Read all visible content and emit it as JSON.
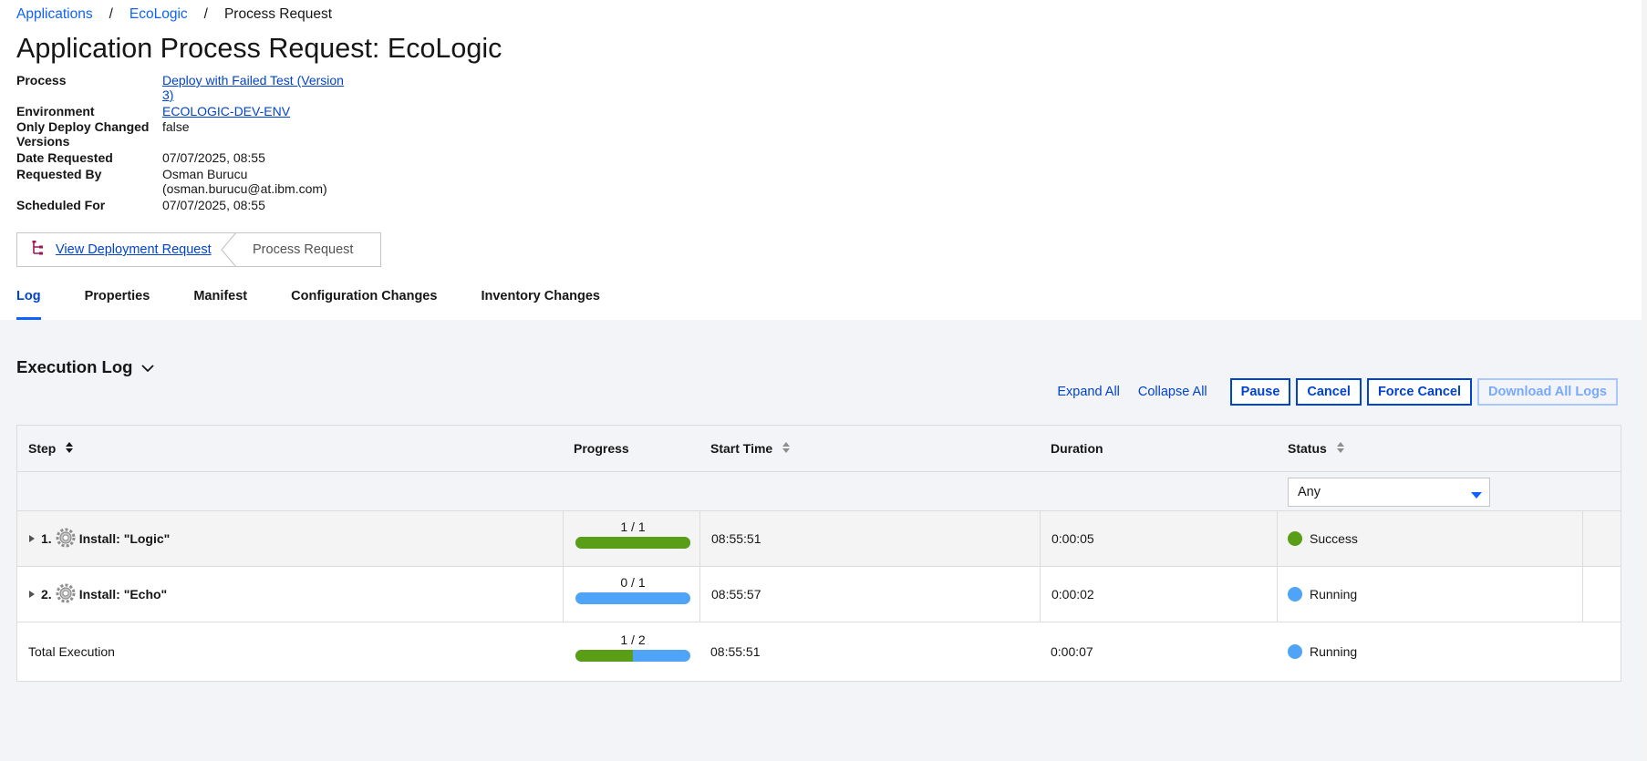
{
  "breadcrumb": {
    "items": [
      "Applications",
      "EcoLogic"
    ],
    "current": "Process Request",
    "separator": "/"
  },
  "title": "Application Process Request: EcoLogic",
  "details": {
    "process": {
      "label": "Process",
      "value_line1": "Deploy with Failed Test (Version",
      "value_line2": "3)"
    },
    "environment": {
      "label": "Environment",
      "value": "ECOLOGIC-DEV-ENV"
    },
    "only_changed": {
      "label_line1": "Only Deploy Changed",
      "label_line2": "Versions",
      "value": "false"
    },
    "date_requested": {
      "label": "Date Requested",
      "value": "07/07/2025, 08:55"
    },
    "requested_by": {
      "label": "Requested By",
      "value_line1": "Osman Burucu",
      "value_line2": "(osman.burucu@at.ibm.com)"
    },
    "scheduled_for": {
      "label": "Scheduled For",
      "value": "07/07/2025, 08:55"
    }
  },
  "switcher": {
    "deployment_label": "View Deployment Request",
    "process_label": "Process Request",
    "icon": "tree-icon"
  },
  "tabs": [
    {
      "label": "Log",
      "active": true
    },
    {
      "label": "Properties",
      "active": false
    },
    {
      "label": "Manifest",
      "active": false
    },
    {
      "label": "Configuration Changes",
      "active": false
    },
    {
      "label": "Inventory Changes",
      "active": false
    }
  ],
  "execution_log": {
    "title": "Execution Log",
    "actions": {
      "expand_all": "Expand All",
      "collapse_all": "Collapse All",
      "pause": "Pause",
      "cancel": "Cancel",
      "force_cancel": "Force Cancel",
      "download_all_logs": "Download All Logs"
    },
    "columns": {
      "step": "Step",
      "progress": "Progress",
      "start_time": "Start Time",
      "duration": "Duration",
      "status": "Status"
    },
    "status_filter": {
      "selected": "Any"
    },
    "rows": [
      {
        "num": "1.",
        "name": "Install: \"Logic\"",
        "progress_text": "1 / 1",
        "progress_fraction": 1.0,
        "start_time": "08:55:51",
        "duration": "0:00:05",
        "status": "Success",
        "status_color": "#5a9e17"
      },
      {
        "num": "2.",
        "name": "Install: \"Echo\"",
        "progress_text": "0 / 1",
        "progress_fraction": 0.0,
        "start_time": "08:55:57",
        "duration": "0:00:02",
        "status": "Running",
        "status_color": "#4fa4f7"
      }
    ],
    "total": {
      "label": "Total Execution",
      "progress_text": "1 / 2",
      "progress_fraction": 0.5,
      "start_time": "08:55:51",
      "duration": "0:00:07",
      "status": "Running",
      "status_color": "#4fa4f7"
    }
  },
  "colors": {
    "link": "#0043ce",
    "accent": "#0f62fe",
    "success": "#5a9e17",
    "running": "#4fa4f7"
  }
}
